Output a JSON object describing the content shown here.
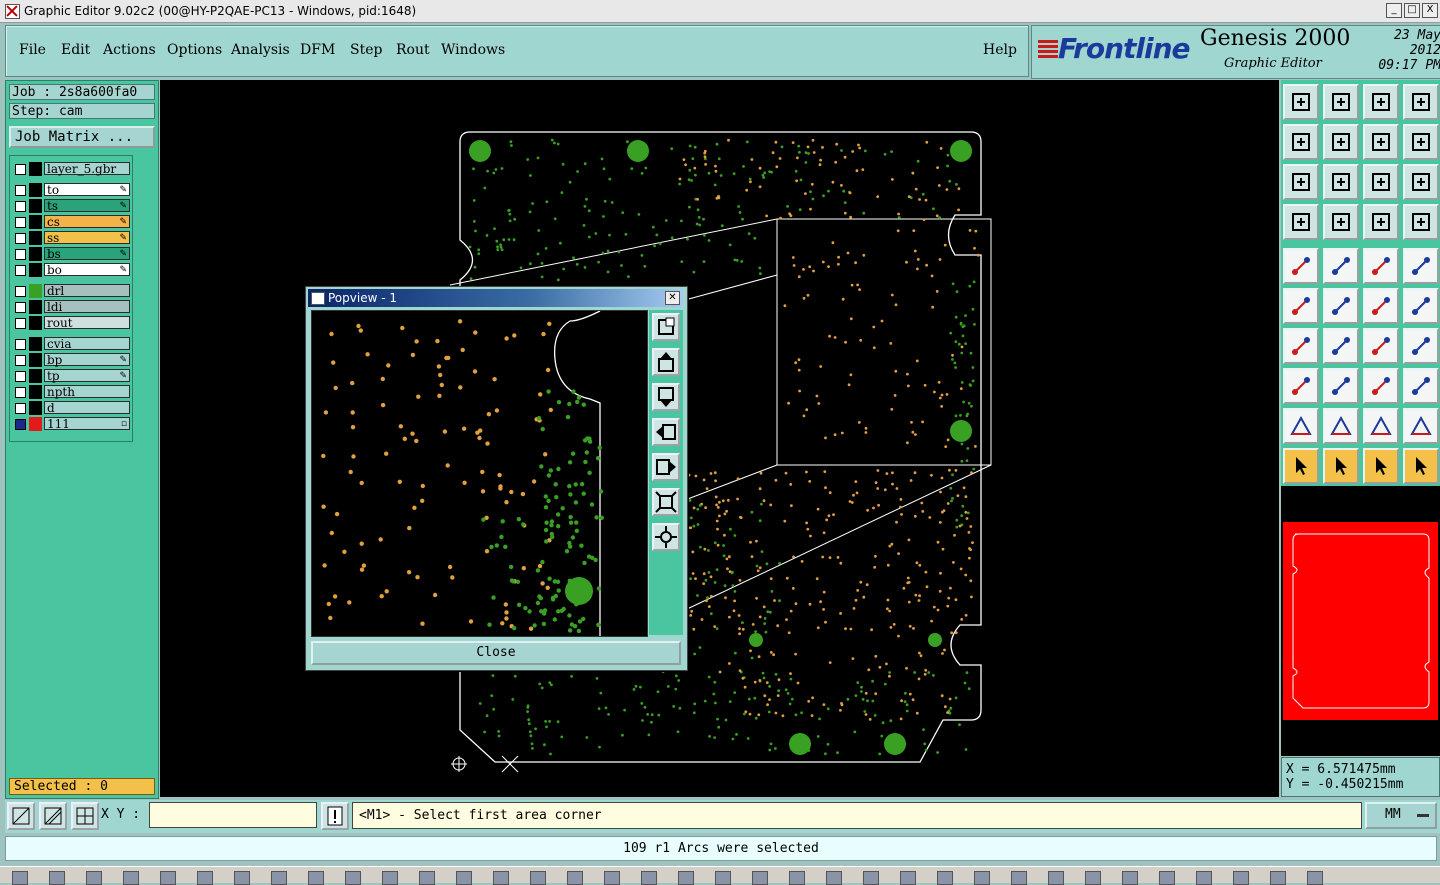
{
  "window": {
    "title": "Graphic Editor 9.02c2 (00@HY-P2QAE-PC13 - Windows, pid:1648)",
    "buttons": [
      "_",
      "□",
      "X"
    ]
  },
  "menu": {
    "items": [
      "File",
      "Edit",
      "Actions",
      "Options",
      "Analysis",
      "DFM",
      "Step",
      "Rout",
      "Windows"
    ],
    "help": "Help"
  },
  "brand": {
    "logo": "Frontline",
    "product": "Genesis 2000",
    "subtitle": "Graphic Editor",
    "date": "23 May 2012",
    "time": "09:17 PM"
  },
  "job": {
    "job_label": "Job : 2s8a600fa0",
    "step_label": "Step: cam",
    "matrix_button": "Job Matrix ..."
  },
  "layers": [
    {
      "name": "layer_5.gbr",
      "color": "#a6d5d1",
      "swatch": "#000000",
      "marker": ""
    },
    {
      "name": "to",
      "color": "#ffffff",
      "swatch": "#000000",
      "marker": "✎"
    },
    {
      "name": "ts",
      "color": "#2aa37a",
      "swatch": "#000000",
      "marker": "✎"
    },
    {
      "name": "cs",
      "color": "#f3b24a",
      "swatch": "#000000",
      "marker": "✎"
    },
    {
      "name": "ss",
      "color": "#f3c04a",
      "swatch": "#000000",
      "marker": "✎"
    },
    {
      "name": "bs",
      "color": "#2aa37a",
      "swatch": "#000000",
      "marker": "✎"
    },
    {
      "name": "bo",
      "color": "#ffffff",
      "swatch": "#000000",
      "marker": "✎"
    },
    {
      "name": "drl",
      "color": "#a6c0c0",
      "swatch": "#3aa023",
      "marker": ""
    },
    {
      "name": "ldi",
      "color": "#a6c0c0",
      "swatch": "#000000",
      "marker": ""
    },
    {
      "name": "rout",
      "color": "#d0e0e0",
      "swatch": "#000000",
      "marker": ""
    },
    {
      "name": "cvia",
      "color": "#a6d5d1",
      "swatch": "#000000",
      "marker": ""
    },
    {
      "name": "bp",
      "color": "#a6d5d1",
      "swatch": "#000000",
      "marker": "✎"
    },
    {
      "name": "tp",
      "color": "#a6d5d1",
      "swatch": "#000000",
      "marker": "✎"
    },
    {
      "name": "npth",
      "color": "#a6d5d1",
      "swatch": "#000000",
      "marker": ""
    },
    {
      "name": "d",
      "color": "#a6d5d1",
      "swatch": "#000000",
      "marker": ""
    },
    {
      "name": "111",
      "color": "#a6d5d1",
      "swatch": "#e21a1a",
      "marker": "▫"
    }
  ],
  "selected": "Selected : 0",
  "popview": {
    "title": "Popview - 1",
    "close_button": "Close"
  },
  "coords": {
    "x": "X = 6.571475mm",
    "y": "Y = -0.450215mm"
  },
  "command": {
    "xy_label": "X Y :",
    "xy_value": "",
    "message": "<M1> - Select first area corner",
    "units": "MM"
  },
  "status": "109 r1 Arcs were selected",
  "colors": {
    "panel": "#9fd6d0",
    "layer_panel": "#49c5a0",
    "canvas": "#000000",
    "pad_green": "#3aa023",
    "pad_orange": "#e0a040",
    "minimap_fill": "#ff0000"
  }
}
